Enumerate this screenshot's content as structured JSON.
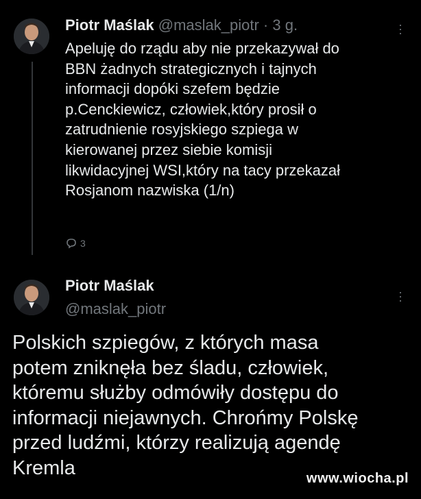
{
  "tweet1": {
    "author_name": "Piotr Maślak",
    "handle": "@maslak_piotr",
    "separator": "·",
    "time": "3 g.",
    "lines": [
      "Apeluję do rządu aby nie przekazywał do",
      "BBN żadnych strategicznych i tajnych",
      "informacji dopóki szefem będzie",
      "p.Cenckiewicz, człowiek,który prosił o",
      "zatrudnienie rosyjskiego szpiega w",
      "kierowanej przez siebie komisji",
      "likwidacyjnej WSI,który na tacy przekazał",
      "Rosjanom nazwiska (1/n)"
    ],
    "reply_icon": "reply-bubble-icon",
    "reply_count": "3"
  },
  "tweet2": {
    "author_name": "Piotr Maślak",
    "handle": "@maslak_piotr",
    "lines": [
      "Polskich szpiegów, z których masa",
      "potem zniknęła bez śladu, człowiek,",
      "któremu służby odmówiły dostępu do",
      "informacji niejawnych. Chrońmy Polskę",
      "przed ludźmi, którzy realizują agendę",
      "Kremla"
    ]
  },
  "watermark": "www.wiocha.pl",
  "colors": {
    "background": "#000000",
    "text_primary": "#e7e9ea",
    "text_secondary": "#71767b",
    "thread_line": "#333639"
  }
}
